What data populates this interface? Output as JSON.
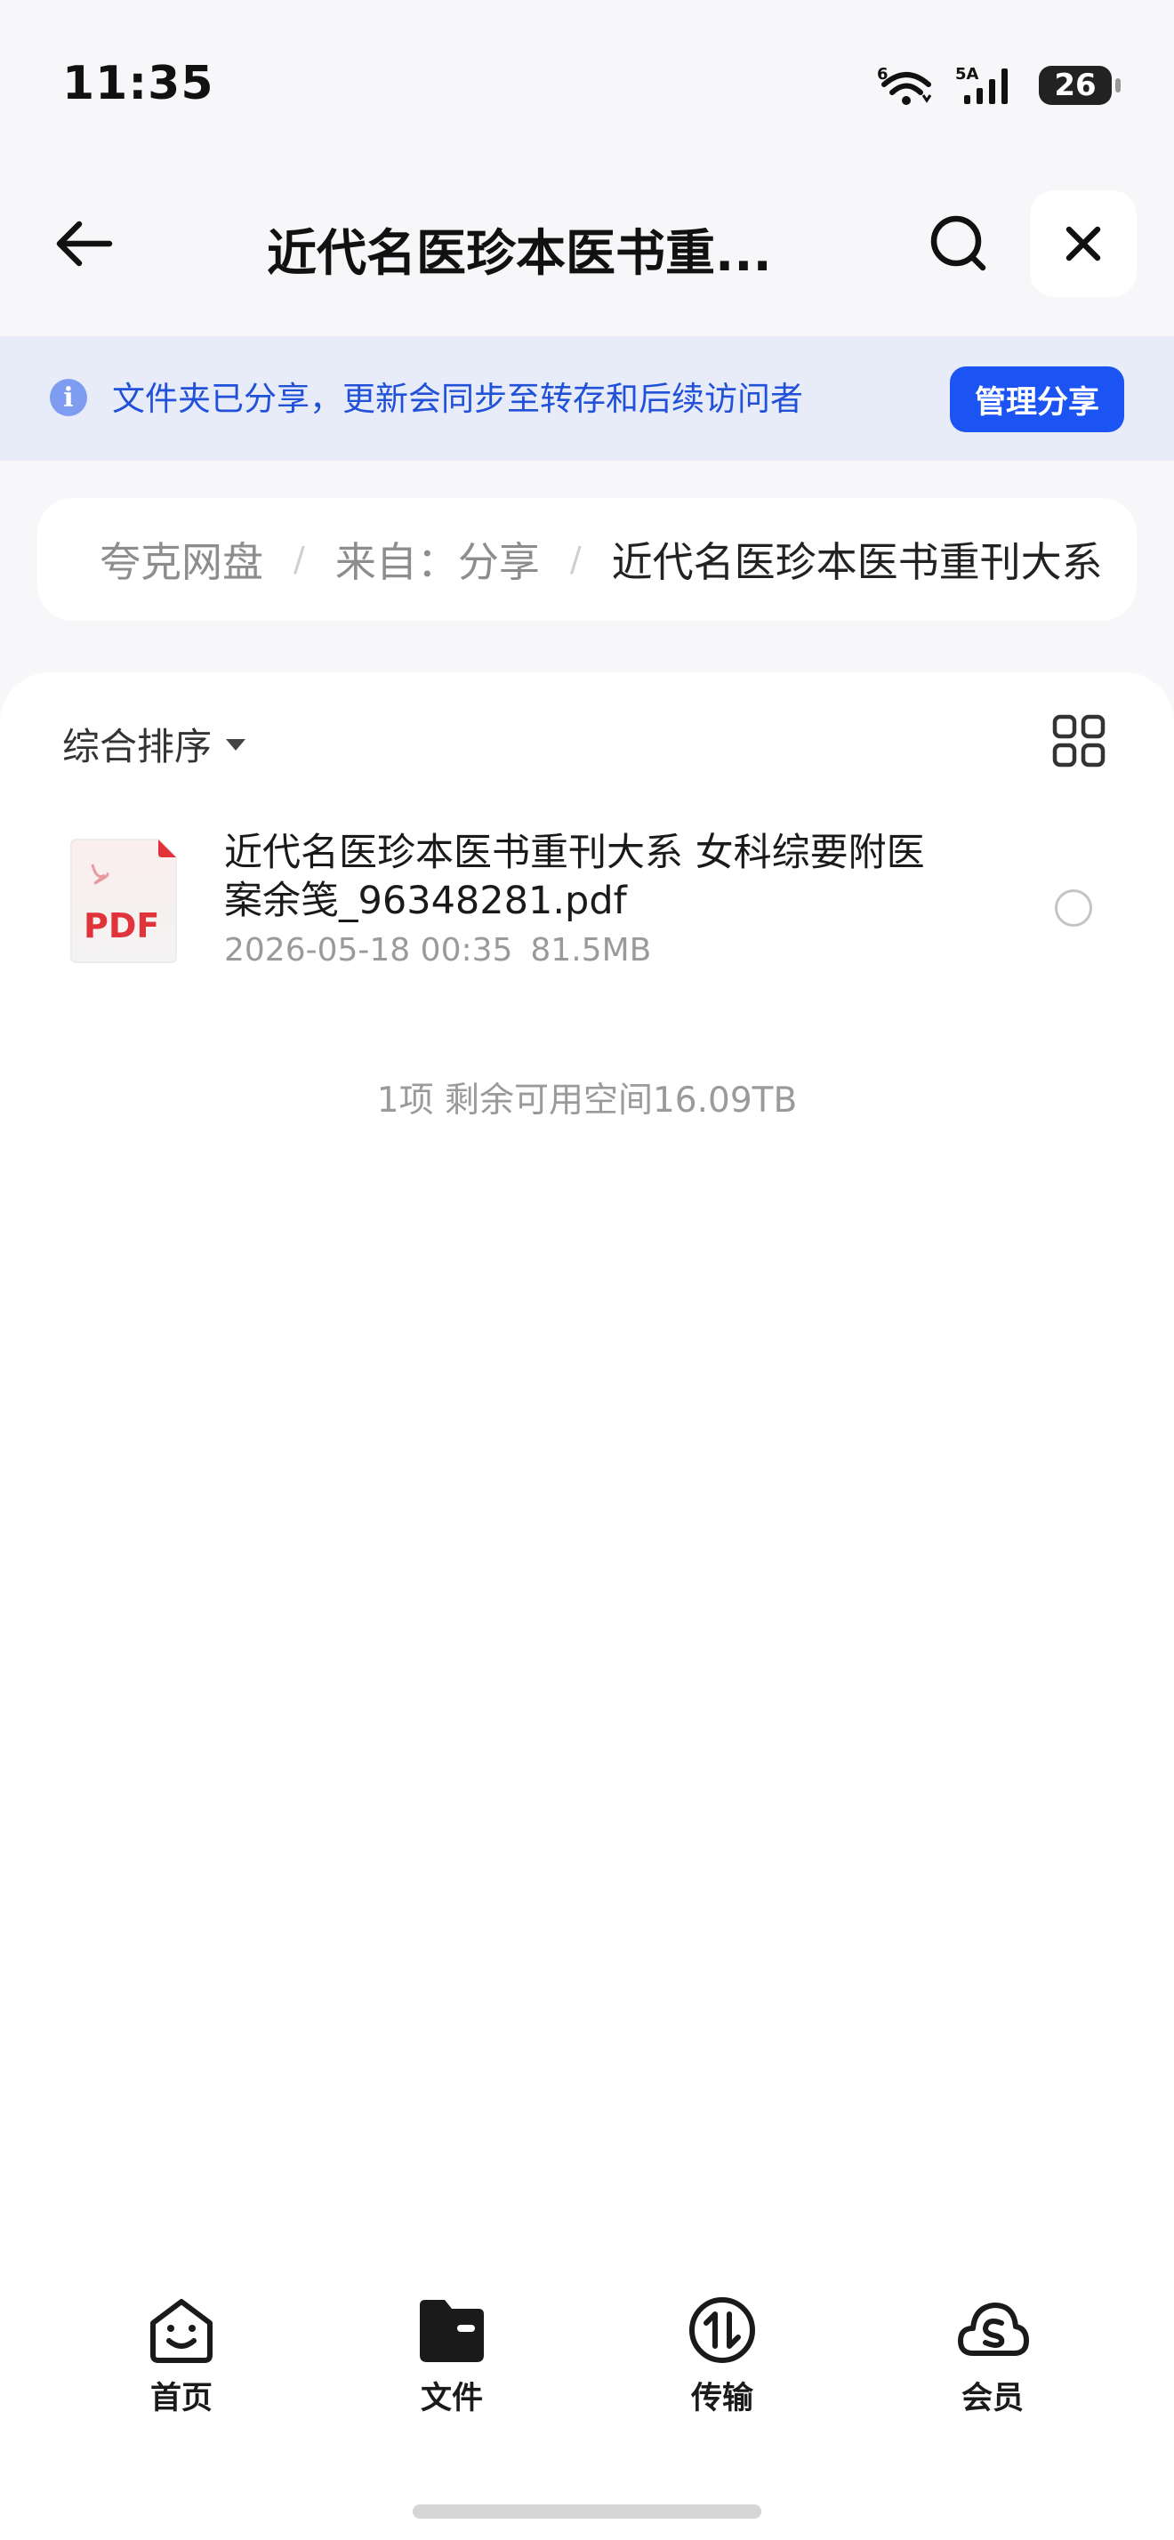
{
  "status_bar": {
    "time": "11:35",
    "wifi_label": "6",
    "signal_label": "5A",
    "battery": "26"
  },
  "header": {
    "title": "近代名医珍本医书重..."
  },
  "share_banner": {
    "text": "文件夹已分享，更新会同步至转存和后续访问者",
    "button_label": "管理分享"
  },
  "breadcrumb": {
    "items": [
      "夸克网盘",
      "来自：分享",
      "近代名医珍本医书重刊大系"
    ]
  },
  "toolbar": {
    "sort_label": "综合排序"
  },
  "files": [
    {
      "name": "近代名医珍本医书重刊大系 女科综要附医案余笺_96348281.pdf",
      "date": "2026-05-18 00:35",
      "size": "81.5MB",
      "icon_label": "PDF"
    }
  ],
  "summary": "1项 剩余可用空间16.09TB",
  "bottom_nav": {
    "items": [
      {
        "label": "首页"
      },
      {
        "label": "文件"
      },
      {
        "label": "传输"
      },
      {
        "label": "会员"
      }
    ]
  },
  "colors": {
    "accent": "#1b54f2",
    "banner_bg": "#e8ecf8",
    "banner_text": "#2051d8",
    "pdf_red": "#e0333a"
  }
}
